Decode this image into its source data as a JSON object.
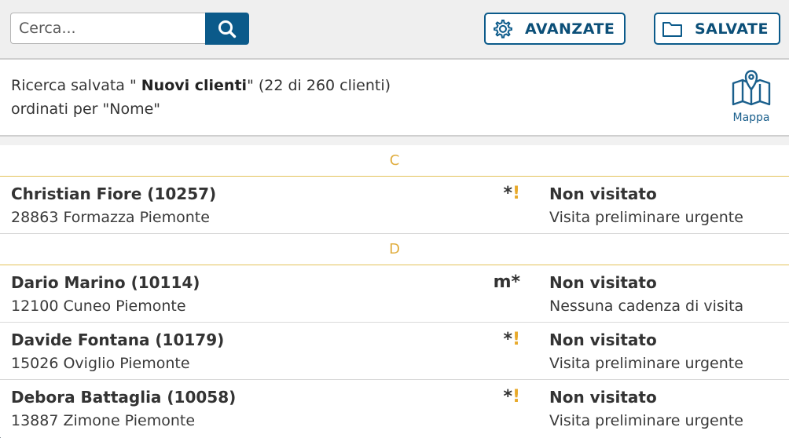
{
  "search": {
    "placeholder": "Cerca..."
  },
  "toolbar": {
    "advanced_label": "AVANZATE",
    "saved_label": "SALVATE"
  },
  "summary": {
    "prefix": "Ricerca salvata \" ",
    "search_name": "Nuovi clienti",
    "suffix": "\" (22 di 260 clienti)",
    "order_line": "ordinati per \"Nome\"",
    "map_label": "Mappa"
  },
  "colors": {
    "primary": "#0b5a8a",
    "accent": "#e0ad3e",
    "warning": "#e8a92a"
  },
  "groups": [
    {
      "letter": "C",
      "clients": [
        {
          "name": "Christian Fiore (10257)",
          "address": "28863 Formazza Piemonte",
          "flag": "*",
          "flag_warn": "!",
          "status": "Non visitato",
          "cadence": "Visita preliminare urgente"
        }
      ]
    },
    {
      "letter": "D",
      "clients": [
        {
          "name": "Dario Marino (10114)",
          "address": "12100 Cuneo Piemonte",
          "flag": "m*",
          "flag_warn": "",
          "status": "Non visitato",
          "cadence": "Nessuna cadenza di visita"
        },
        {
          "name": "Davide Fontana (10179)",
          "address": "15026 Oviglio Piemonte",
          "flag": "*",
          "flag_warn": "!",
          "status": "Non visitato",
          "cadence": "Visita preliminare urgente"
        },
        {
          "name": "Debora Battaglia (10058)",
          "address": "13887 Zimone Piemonte",
          "flag": "*",
          "flag_warn": "!",
          "status": "Non visitato",
          "cadence": "Visita preliminare urgente"
        }
      ]
    }
  ]
}
